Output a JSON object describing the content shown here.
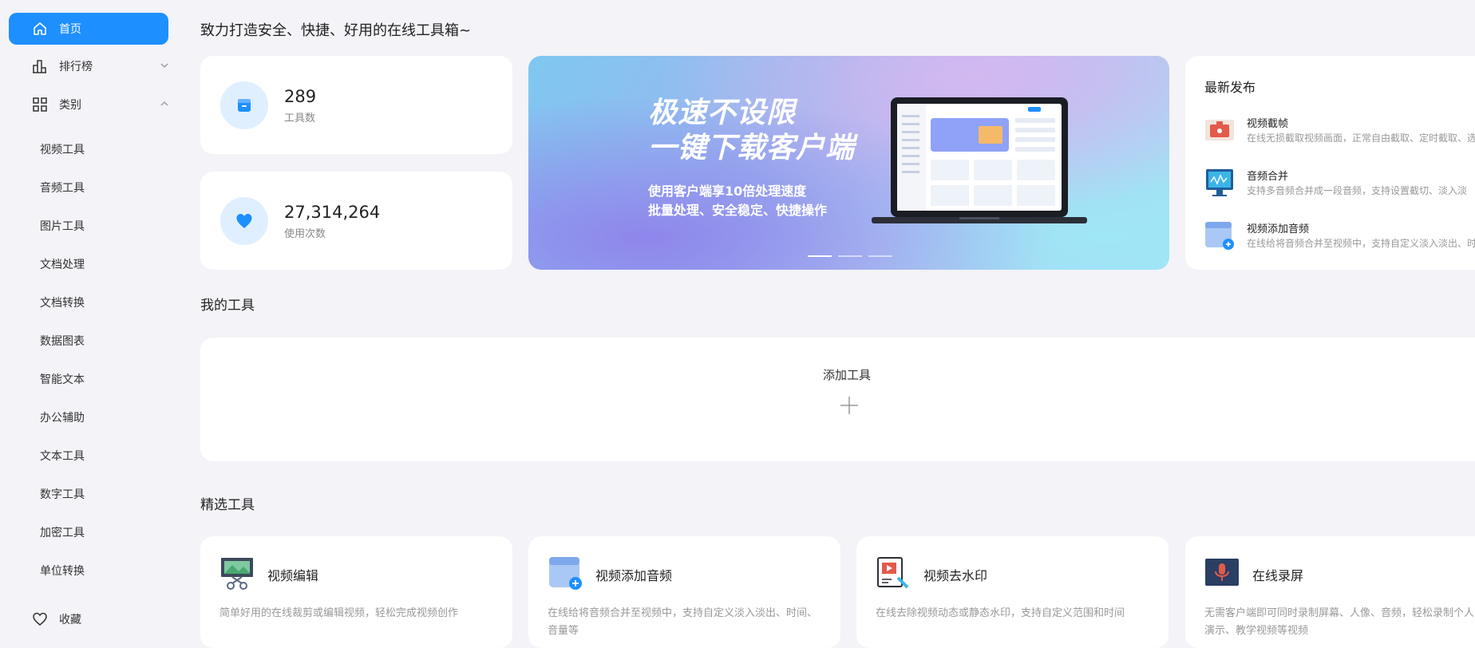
{
  "sidebar": {
    "home": "首页",
    "ranking": "排行榜",
    "category": "类别",
    "categories": [
      "视频工具",
      "音频工具",
      "图片工具",
      "文档处理",
      "文档转换",
      "数据图表",
      "智能文本",
      "办公辅助",
      "文本工具",
      "数字工具",
      "加密工具",
      "单位转换"
    ],
    "favorites": "收藏"
  },
  "header": {
    "slogan": "致力打造安全、快捷、好用的在线工具箱~"
  },
  "stats": [
    {
      "value": "289",
      "label": "工具数"
    },
    {
      "value": "27,314,264",
      "label": "使用次数"
    }
  ],
  "banner": {
    "line1": "极速不设限",
    "line2": "一键下载客户端",
    "sub1": "使用客户端享10倍处理速度",
    "sub2": "批量处理、安全稳定、快捷操作",
    "slide_count": 3,
    "active_slide": 1
  },
  "latest": {
    "title": "最新发布",
    "items": [
      {
        "name": "视频截帧",
        "desc": "在线无损截取视频画面，正常自由截取、定时截取、选"
      },
      {
        "name": "音频合并",
        "desc": "支持多音频合并成一段音频，支持设置截切、淡入淡"
      },
      {
        "name": "视频添加音频",
        "desc": "在线给将音频合并至视频中，支持自定义淡入淡出、时"
      }
    ]
  },
  "my_tools": {
    "title": "我的工具",
    "add_label": "添加工具"
  },
  "featured": {
    "title": "精选工具",
    "tools": [
      {
        "name": "视频编辑",
        "desc": "简单好用的在线裁剪或编辑视频，轻松完成视频创作"
      },
      {
        "name": "视频添加音频",
        "desc": "在线给将音频合并至视频中，支持自定义淡入淡出、时间、音量等"
      },
      {
        "name": "视频去水印",
        "desc": "在线去除视频动态或静态水印，支持自定义范围和时间"
      },
      {
        "name": "在线录屏",
        "desc": "无需客户端即可同时录制屏幕、人像、音频，轻松录制个人演示、教学视频等视频"
      }
    ]
  },
  "colors": {
    "accent": "#1e8fff",
    "background": "#f3f3f8"
  }
}
